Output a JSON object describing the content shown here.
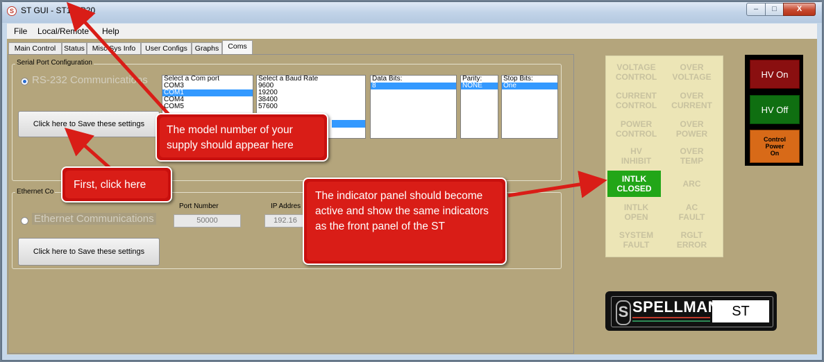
{
  "window": {
    "title": "ST GUI - ST120P20",
    "icon": "spellman-s-icon",
    "controls": {
      "minimize": "–",
      "maximize": "□",
      "close": "X"
    }
  },
  "menu": [
    "File",
    "Local/Remote",
    "Help"
  ],
  "tabs": [
    "Main Control",
    "Status",
    "Misc Sys Info",
    "User Configs",
    "Graphs",
    "Coms"
  ],
  "active_tab": "Coms",
  "serial": {
    "group_label": "Serial Port Configuration",
    "radio_label": "RS-232 Communications",
    "save_button": "Click here to Save these settings",
    "com_list": {
      "header": "Select a Com port",
      "items": [
        "COM3",
        "COM1",
        "COM4",
        "COM5"
      ],
      "selected": "COM1"
    },
    "baud_list": {
      "header": "Select a Baud Rate",
      "items": [
        "9600",
        "19200",
        "38400",
        "57600"
      ]
    },
    "data_bits": {
      "header": "Data Bits:",
      "items": [
        "8"
      ]
    },
    "parity": {
      "header": "Parity:",
      "items": [
        "NONE"
      ]
    },
    "stop_bits": {
      "header": "Stop Bits:",
      "items": [
        "One"
      ]
    }
  },
  "ethernet": {
    "group_label": "Ethernet Co",
    "radio_label": "Ethernet Communications",
    "port_label": "Port Number",
    "port_value": "50000",
    "ip_label": "IP Addres",
    "ip_value": "192.16",
    "save_button": "Click here to Save these settings"
  },
  "indicators": [
    {
      "label": "VOLTAGE\nCONTROL",
      "active": false
    },
    {
      "label": "OVER\nVOLTAGE",
      "active": false
    },
    {
      "label": "CURRENT\nCONTROL",
      "active": false
    },
    {
      "label": "OVER\nCURRENT",
      "active": false
    },
    {
      "label": "POWER\nCONTROL",
      "active": false
    },
    {
      "label": "OVER\nPOWER",
      "active": false
    },
    {
      "label": "HV\nINHIBIT",
      "active": false
    },
    {
      "label": "OVER\nTEMP",
      "active": false
    },
    {
      "label": "INTLK\nCLOSED",
      "active": true
    },
    {
      "label": "ARC",
      "active": false
    },
    {
      "label": "INTLK\nOPEN",
      "active": false
    },
    {
      "label": "AC\nFAULT",
      "active": false
    },
    {
      "label": "SYSTEM\nFAULT",
      "active": false
    },
    {
      "label": "RGLT\nERROR",
      "active": false
    }
  ],
  "hv_buttons": {
    "on": "HV On",
    "off": "HV Off",
    "control_power": "Control\nPower\nOn"
  },
  "logo": {
    "brand": "SPELLMAN",
    "model": "ST"
  },
  "callouts": {
    "model": "The model number of your supply should appear here",
    "first": "First, click here",
    "indicator": "The indicator panel should become active and show the same indicators as the front panel of the ST"
  },
  "colors": {
    "background": "#b4a57c",
    "indicator_panel": "#ece5b6",
    "active_indicator": "#22a618",
    "callout": "#d91d17"
  }
}
